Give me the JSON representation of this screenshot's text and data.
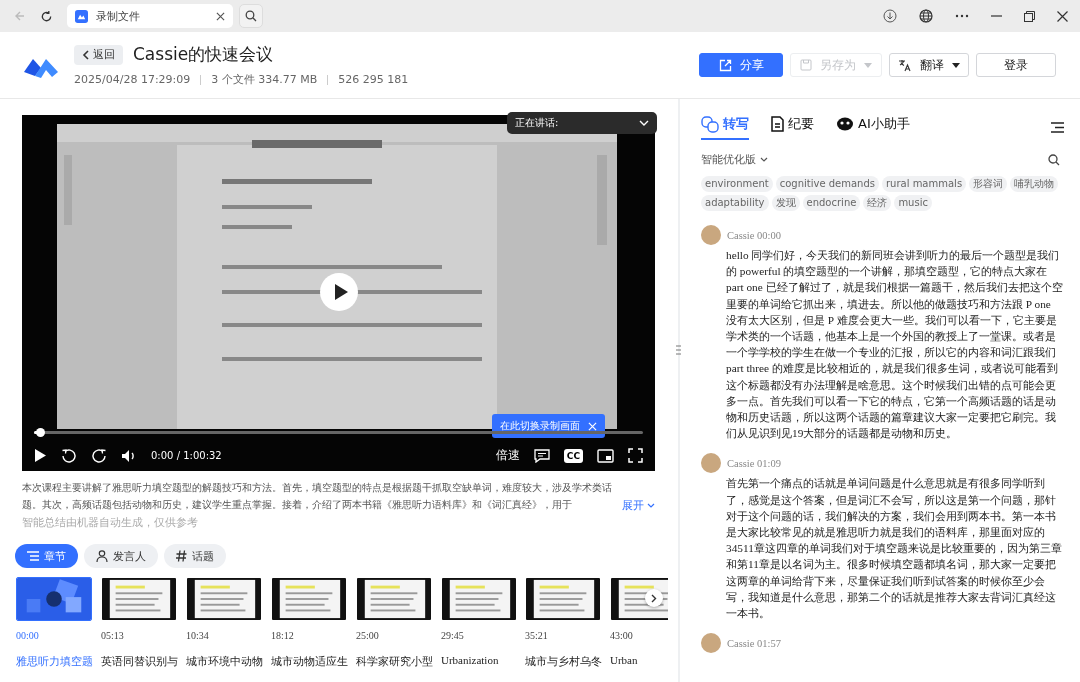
{
  "browser": {
    "tab_title": "录制文件"
  },
  "header": {
    "back_label": "返回",
    "title": "Cassie的快速会议",
    "date": "2025/04/28 17:29:09",
    "files": "3 个文件 334.77 MB",
    "meeting_id": "526 295 181",
    "buttons": [
      {
        "label": "分享",
        "kind": "share",
        "disabled": false
      },
      {
        "label": "另存为",
        "kind": "save",
        "disabled": true
      },
      {
        "label": "翻译",
        "kind": "translate",
        "disabled": false
      },
      {
        "label": "登录",
        "kind": "login",
        "disabled": false
      }
    ]
  },
  "player": {
    "speaking_label": "正在讲话:",
    "switch_tip": "在此切换录制画面",
    "time": "0:00 / 1:00:32",
    "speed": "倍速",
    "captions": "CC",
    "progress": {
      "level": 0.01
    }
  },
  "summary": {
    "text": "本次课程主要讲解了雅思听力填空题型的解题技巧和方法。首先，填空题型的特点是根据题干抓取空缺单词，难度较大，涉及学术类话题。其次，高频话题包括动物和历史，建议学生重点掌握。接着，介绍了两本书籍《雅思听力语料库》和《词汇真经》，用于",
    "expand": "展开",
    "note": "智能总结由机器自动生成，仅供参考"
  },
  "chapter_tabs": [
    {
      "label": "章节",
      "kind": "chapters",
      "selected": true
    },
    {
      "label": "发言人",
      "kind": "speakers",
      "selected": false
    },
    {
      "label": "话题",
      "kind": "topics",
      "selected": false
    }
  ],
  "chapters": [
    {
      "time": "00:00",
      "title": "雅思听力填空题",
      "selected": true
    },
    {
      "time": "05:13",
      "title": "英语同替识别与",
      "selected": false
    },
    {
      "time": "10:34",
      "title": "城市环境中动物",
      "selected": false
    },
    {
      "time": "18:12",
      "title": "城市动物适应生",
      "selected": false
    },
    {
      "time": "25:00",
      "title": "科学家研究小型",
      "selected": false
    },
    {
      "time": "29:45",
      "title": "Urbanization",
      "selected": false
    },
    {
      "time": "35:21",
      "title": "城市与乡村乌冬",
      "selected": false
    },
    {
      "time": "43:00",
      "title": "Urban",
      "selected": false
    }
  ],
  "panel_tabs": [
    {
      "label": "转写",
      "kind": "transcript",
      "selected": true
    },
    {
      "label": "纪要",
      "kind": "minutes",
      "selected": false
    },
    {
      "label": "AI小助手",
      "kind": "assistant",
      "selected": false
    }
  ],
  "version": "智能优化版",
  "tags": [
    "environment",
    "cognitive demands",
    "rural mammals",
    "形容词",
    "哺乳动物",
    "adaptability",
    "发现",
    "endocrine",
    "经济",
    "music"
  ],
  "transcript": [
    {
      "speaker": "Cassie 00:00",
      "text": "hello 同学们好，今天我们的新同班会讲到听力的最后一个题型是我们的 powerful 的填空题型的一个讲解，那填空题型，它的特点大家在 part one 已经了解过了，就是我们根据一篇题干，然后我们去把这个空里要的单词给它抓出来，填进去。所以他的做题技巧和方法跟 P one 没有太大区别，但是 P 难度会更大一些。我们可以看一下，它主要是学术类的一个话题，他基本上是一个外国的教授上了一堂课。或者是一个学学校的学生在做一个专业的汇报，所以它的内容和词汇跟我们 part three 的难度是比较相近的，就是我们很多生词，或者说可能看到这个标题都没有办法理解是啥意思。这个时候我们出错的点可能会更多一点。首先我们可以看一下它的特点，它第一个高频话题的话是动物和历史话题，所以这两个话题的篇章建议大家一定要把它刷完。我们从见识到见19大部分的话题都是动物和历史。"
    },
    {
      "speaker": "Cassie 01:09",
      "text": "首先第一个痛点的话就是单词问题是什么意思就是有很多同学听到了，感觉是这个答案，但是词汇不会写，所以这是第一个问题，那针对于这个问题的话，我们解决的方案，我们会用到两本书。第一本书是大家比较常见的就是雅思听力就是我们的语料库，那里面对应的34511章这四章的单词我们对于填空题来说是比较重要的，因为第三章和第11章是以名词为主。很多时候填空题都填名词，那大家一定要把这两章的单词给背下来，尽量保证我们听到试答案的时候你至少会写，我知道是什么意思，那第二个的话就是推荐大家去背词汇真经这一本书。"
    },
    {
      "speaker": "Cassie 01:57"
    }
  ]
}
